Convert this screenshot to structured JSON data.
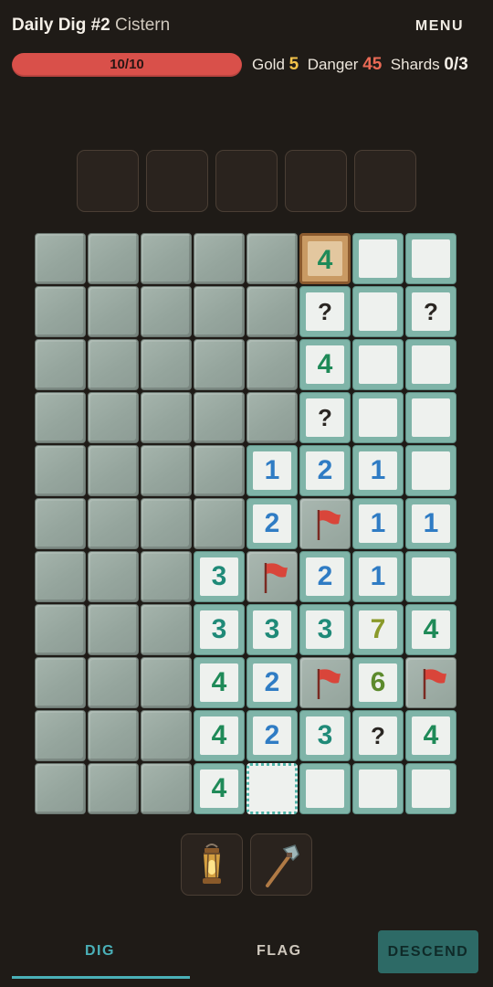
{
  "header": {
    "title": "Daily Dig #2",
    "location": "Cistern",
    "menu_label": "MENU"
  },
  "health": {
    "text": "10/10",
    "fraction": 1.0
  },
  "stats": {
    "gold_label": "Gold",
    "gold_value": "5",
    "danger_label": "Danger",
    "danger_value": "45",
    "shards_label": "Shards",
    "shards_value": "0/3"
  },
  "inventory_slots": 5,
  "board": {
    "rows": [
      [
        "H",
        "H",
        "H",
        "H",
        "H",
        "S4",
        "O",
        "O"
      ],
      [
        "H",
        "H",
        "H",
        "H",
        "H",
        "?",
        "O",
        "?"
      ],
      [
        "H",
        "H",
        "H",
        "H",
        "H",
        "4",
        "O",
        "O"
      ],
      [
        "H",
        "H",
        "H",
        "H",
        "H",
        "?",
        "O",
        "O"
      ],
      [
        "H",
        "H",
        "H",
        "H",
        "1",
        "2",
        "1",
        "O"
      ],
      [
        "H",
        "H",
        "H",
        "H",
        "2",
        "F",
        "1",
        "1"
      ],
      [
        "H",
        "H",
        "H",
        "3",
        "F",
        "2",
        "1",
        "O"
      ],
      [
        "H",
        "H",
        "H",
        "3",
        "3",
        "3",
        "7",
        "4"
      ],
      [
        "H",
        "H",
        "H",
        "4",
        "2",
        "F",
        "6",
        "F"
      ],
      [
        "H",
        "H",
        "H",
        "4",
        "2",
        "3",
        "?",
        "4"
      ],
      [
        "H",
        "H",
        "H",
        "4",
        "SEL",
        "O",
        "O",
        "O"
      ]
    ]
  },
  "tools": [
    {
      "name": "lantern",
      "icon": "lantern-icon"
    },
    {
      "name": "pickaxe",
      "icon": "pickaxe-icon"
    }
  ],
  "tabs": {
    "dig": "DIG",
    "flag": "FLAG",
    "descend": "DESCEND"
  },
  "colors": {
    "accent": "#4ab0b8",
    "health": "#d9504a",
    "gold": "#f2c24a",
    "danger": "#ea6a55"
  }
}
